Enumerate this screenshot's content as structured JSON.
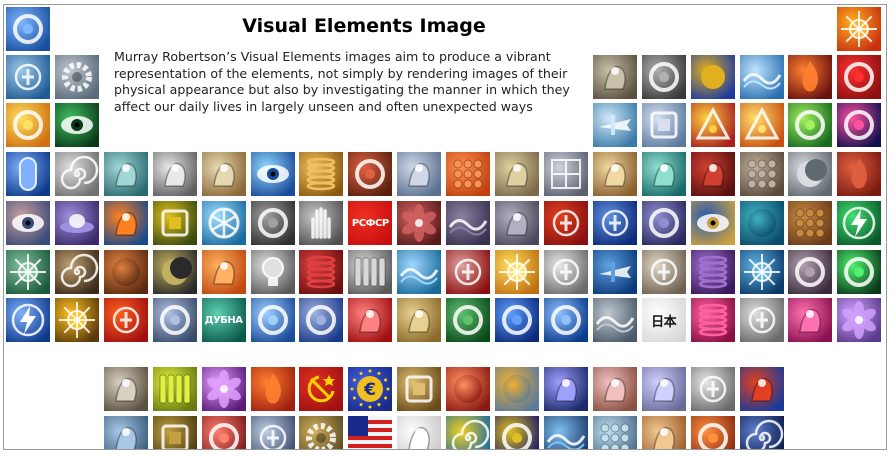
{
  "slide": {
    "title": "Visual Elements Image",
    "description": "Murray Robertson’s Visual Elements images aim to produce a vibrant representation of the elements, not simply by rendering images of their physical appearance but also by investigating the manner in which they affect our daily lives in largely unseen and often unexpected ways"
  },
  "tile_text": {
    "rsfsr": "РСФСР",
    "dubna": "ДУБНА",
    "nihon": "日本"
  },
  "palette": {
    "blue": "#1f4fa8",
    "darkblue": "#0e2a66",
    "red": "#c8281e",
    "orange": "#e8781e",
    "gold": "#c9a23a",
    "green": "#2e8a3a",
    "purple": "#6a3ca0",
    "grey": "#8a8f96",
    "teal": "#1f8f8f",
    "brown": "#7a5230"
  },
  "rows": [
    {
      "id": "r1",
      "tiles": [
        {
          "c1": "#1a4fa0",
          "c2": "#7fb6ff",
          "icon": "ring"
        },
        {
          "c1": "#c83010",
          "c2": "#ffb020",
          "icon": "sun"
        }
      ]
    },
    {
      "id": "r2",
      "tiles": [
        {
          "c1": "#1e5a96",
          "c2": "#9fc8e8",
          "icon": "symbol"
        },
        {
          "c1": "#5a6a7a",
          "c2": "#c0c8d0",
          "icon": "gear"
        },
        {
          "c1": "#5a5040",
          "c2": "#c8c0a8",
          "icon": "figure"
        },
        {
          "c1": "#3a3a3a",
          "c2": "#b0b0b0",
          "icon": "ring"
        },
        {
          "c1": "#1e3aa0",
          "c2": "#e0b020",
          "icon": "wheat"
        },
        {
          "c1": "#2a6fb0",
          "c2": "#c0e4ff",
          "icon": "wave"
        },
        {
          "c1": "#6a1010",
          "c2": "#ff8030",
          "icon": "flame"
        },
        {
          "c1": "#8a1010",
          "c2": "#ff3030",
          "icon": "ring"
        }
      ]
    },
    {
      "id": "r3",
      "tiles": [
        {
          "c1": "#d07010",
          "c2": "#ffe060",
          "icon": "ring"
        },
        {
          "c1": "#0a3a1a",
          "c2": "#40c060",
          "icon": "eye"
        },
        {
          "c1": "#3a7aa8",
          "c2": "#d0e8f8",
          "icon": "plane"
        },
        {
          "c1": "#5a7aa0",
          "c2": "#d8e0f0",
          "icon": "box"
        },
        {
          "c1": "#a82020",
          "c2": "#ffd040",
          "icon": "triangle"
        },
        {
          "c1": "#c85010",
          "c2": "#ffe070",
          "icon": "triangle"
        },
        {
          "c1": "#186a20",
          "c2": "#a0f060",
          "icon": "ring"
        },
        {
          "c1": "#101050",
          "c2": "#ff50a0",
          "icon": "ring"
        }
      ]
    },
    {
      "id": "r4",
      "tiles": [
        {
          "c1": "#0e3a8a",
          "c2": "#80b0ff",
          "icon": "capsule"
        },
        {
          "c1": "#707070",
          "c2": "#e0e0e0",
          "icon": "spiral"
        },
        {
          "c1": "#2a6a70",
          "c2": "#a0d8d8",
          "icon": "figure"
        },
        {
          "c1": "#606060",
          "c2": "#e8e8e8",
          "icon": "figure"
        },
        {
          "c1": "#8a6a3a",
          "c2": "#e8d8b0",
          "icon": "figure"
        },
        {
          "c1": "#1a4a9a",
          "c2": "#90d8ff",
          "icon": "eye"
        },
        {
          "c1": "#8a5a10",
          "c2": "#f0c060",
          "icon": "coil"
        },
        {
          "c1": "#5a2010",
          "c2": "#e06040",
          "icon": "ring"
        },
        {
          "c1": "#5a7090",
          "c2": "#d0d8e8",
          "icon": "figure"
        },
        {
          "c1": "#c04010",
          "c2": "#ff9050",
          "icon": "dots"
        },
        {
          "c1": "#7a6a4a",
          "c2": "#e0d0a0",
          "icon": "figure"
        },
        {
          "c1": "#5a6070",
          "c2": "#d0d4dc",
          "icon": "grid"
        },
        {
          "c1": "#8a6030",
          "c2": "#f0d8a0",
          "icon": "figure"
        },
        {
          "c1": "#1a6a6a",
          "c2": "#90e0d0",
          "icon": "figure"
        },
        {
          "c1": "#5a1010",
          "c2": "#d04030",
          "icon": "figure"
        },
        {
          "c1": "#5a4a3a",
          "c2": "#c0b0a0",
          "icon": "dots"
        },
        {
          "c1": "#606870",
          "c2": "#d8dce0",
          "icon": "moon"
        },
        {
          "c1": "#7a1a10",
          "c2": "#e06040",
          "icon": "flame"
        },
        {
          "c1": "#3a1020",
          "c2": "#c03050",
          "icon": "capsule"
        }
      ]
    },
    {
      "id": "r5",
      "tiles": [
        {
          "c1": "#3a4a7a",
          "c2": "#c8a0a0",
          "icon": "eye"
        },
        {
          "c1": "#3a2a6a",
          "c2": "#a090e0",
          "icon": "ufo"
        },
        {
          "c1": "#1a4a8a",
          "c2": "#ff8020",
          "icon": "figure"
        },
        {
          "c1": "#3a4a10",
          "c2": "#e0c020",
          "icon": "box"
        },
        {
          "c1": "#1a6aa0",
          "c2": "#a0e0ff",
          "icon": "wheel"
        },
        {
          "c1": "#303030",
          "c2": "#a0a0a0",
          "icon": "ring"
        },
        {
          "c1": "#505050",
          "c2": "#c8c8c8",
          "icon": "hand"
        },
        {
          "c1": "#c81010",
          "c2": "#f03020",
          "icon": "rsfsr"
        },
        {
          "c1": "#5a1a1a",
          "c2": "#d06060",
          "icon": "flower"
        },
        {
          "c1": "#3a3050",
          "c2": "#8a80a0",
          "icon": "wave"
        },
        {
          "c1": "#4a4a5a",
          "c2": "#b0b0c0",
          "icon": "figure"
        },
        {
          "c1": "#8a1010",
          "c2": "#e04020",
          "icon": "symbol"
        },
        {
          "c1": "#0e2a7a",
          "c2": "#6090e0",
          "icon": "symbol"
        },
        {
          "c1": "#2a2a60",
          "c2": "#9090d0",
          "icon": "ring"
        },
        {
          "c1": "#c8a040",
          "c2": "#2a5ab0",
          "icon": "eye"
        },
        {
          "c1": "#0a4a6a",
          "c2": "#40b0c0",
          "icon": "sphere"
        },
        {
          "c1": "#6a3a1a",
          "c2": "#c88a40",
          "icon": "dots"
        },
        {
          "c1": "#0a5a2a",
          "c2": "#40e070",
          "icon": "bolt"
        }
      ]
    },
    {
      "id": "r6",
      "tiles": [
        {
          "c1": "#1a5a3a",
          "c2": "#80c0a0",
          "icon": "sun"
        },
        {
          "c1": "#3a2a1a",
          "c2": "#c0a070",
          "icon": "spiral"
        },
        {
          "c1": "#5a2a10",
          "c2": "#e08040",
          "icon": "sphere"
        },
        {
          "c1": "#2a2a2a",
          "c2": "#c0b060",
          "icon": "moon"
        },
        {
          "c1": "#c04a10",
          "c2": "#ffb060",
          "icon": "figure"
        },
        {
          "c1": "#5a5a5a",
          "c2": "#e0e0e0",
          "icon": "bulb"
        },
        {
          "c1": "#6a1010",
          "c2": "#e04040",
          "icon": "coil"
        },
        {
          "c1": "#5a5a5a",
          "c2": "#d8d8d8",
          "icon": "bars"
        },
        {
          "c1": "#1a6a9a",
          "c2": "#a0d8ff",
          "icon": "wave"
        },
        {
          "c1": "#8a1010",
          "c2": "#e0a0a0",
          "icon": "symbol"
        },
        {
          "c1": "#c07010",
          "c2": "#ffe060",
          "icon": "sun"
        },
        {
          "c1": "#6a6a6a",
          "c2": "#e8e8e8",
          "icon": "symbol"
        },
        {
          "c1": "#0a3a7a",
          "c2": "#60a0e0",
          "icon": "plane"
        },
        {
          "c1": "#706050",
          "c2": "#e0d8c8",
          "icon": "symbol"
        },
        {
          "c1": "#3a1a5a",
          "c2": "#a070d0",
          "icon": "coil"
        },
        {
          "c1": "#0a3a6a",
          "c2": "#60b0e0",
          "icon": "sun"
        },
        {
          "c1": "#3a2a3a",
          "c2": "#b0a0b0",
          "icon": "ring"
        },
        {
          "c1": "#0a3a1a",
          "c2": "#50f070",
          "icon": "ring"
        }
      ]
    },
    {
      "id": "r7",
      "tiles": [
        {
          "c1": "#0e3a8a",
          "c2": "#80b0ff",
          "icon": "bolt"
        },
        {
          "c1": "#5a3a0a",
          "c2": "#ffc020",
          "icon": "sun"
        },
        {
          "c1": "#a01010",
          "c2": "#ff6020",
          "icon": "symbol"
        },
        {
          "c1": "#3a4a6a",
          "c2": "#b0c0e0",
          "icon": "ring"
        },
        {
          "c1": "#0a5a4a",
          "c2": "#60d0b0",
          "icon": "dubna"
        },
        {
          "c1": "#1a4a9a",
          "c2": "#a0d0ff",
          "icon": "ring"
        },
        {
          "c1": "#1a3a8a",
          "c2": "#a0b0e0",
          "icon": "ring"
        },
        {
          "c1": "#a01010",
          "c2": "#ff8080",
          "icon": "figure"
        },
        {
          "c1": "#8a6a2a",
          "c2": "#e8d090",
          "icon": "figure"
        },
        {
          "c1": "#0a4a1a",
          "c2": "#60c070",
          "icon": "ring"
        },
        {
          "c1": "#0a2a7a",
          "c2": "#60a0ff",
          "icon": "ring"
        },
        {
          "c1": "#0a3a8a",
          "c2": "#90c0ff",
          "icon": "ring"
        },
        {
          "c1": "#4a5a6a",
          "c2": "#c0c8d0",
          "icon": "wave"
        },
        {
          "c1": "#d8d8d8",
          "c2": "#ffffff",
          "icon": "nihon"
        },
        {
          "c1": "#8a1040",
          "c2": "#ff60a0",
          "icon": "coil"
        },
        {
          "c1": "#6a6a6a",
          "c2": "#e0e0e0",
          "icon": "symbol"
        },
        {
          "c1": "#8a1050",
          "c2": "#ff70b0",
          "icon": "figure"
        },
        {
          "c1": "#5a3a8a",
          "c2": "#d0a0ff",
          "icon": "flower"
        },
        {
          "c1": "#2a6a2a",
          "c2": "#e0c040",
          "icon": "bars"
        }
      ]
    },
    {
      "id": "r8",
      "tiles": [
        {
          "c1": "#5a5040",
          "c2": "#d8d0c0",
          "icon": "figure"
        },
        {
          "c1": "#6a7a10",
          "c2": "#e0f040",
          "icon": "bars"
        },
        {
          "c1": "#5a1a7a",
          "c2": "#e0a0ff",
          "icon": "flower"
        },
        {
          "c1": "#a02010",
          "c2": "#ff8030",
          "icon": "flame"
        },
        {
          "c1": "#a01010",
          "c2": "#e03020",
          "icon": "hammer"
        },
        {
          "c1": "#1a2a8a",
          "c2": "#4060e0",
          "icon": "euro"
        },
        {
          "c1": "#6a4a1a",
          "c2": "#e0c070",
          "icon": "box"
        },
        {
          "c1": "#8a1a10",
          "c2": "#ff9060",
          "icon": "sphere"
        },
        {
          "c1": "#5a7a9a",
          "c2": "#f0b030",
          "icon": "sphere"
        },
        {
          "c1": "#1a2a6a",
          "c2": "#a0a0ff",
          "icon": "figure"
        },
        {
          "c1": "#8a5040",
          "c2": "#f0c0c0",
          "icon": "figure"
        },
        {
          "c1": "#6a6a9a",
          "c2": "#d0d0ff",
          "icon": "figure"
        },
        {
          "c1": "#6a6a6a",
          "c2": "#e8e8e8",
          "icon": "symbol"
        },
        {
          "c1": "#1a3a9a",
          "c2": "#e04020",
          "icon": "figure"
        }
      ]
    },
    {
      "id": "r9",
      "tiles": [
        {
          "c1": "#3a5a7a",
          "c2": "#a8c8e8",
          "icon": "figure"
        },
        {
          "c1": "#4a3a10",
          "c2": "#c0a040",
          "icon": "box"
        },
        {
          "c1": "#7a1a1a",
          "c2": "#ff8070",
          "icon": "ring"
        },
        {
          "c1": "#3a4a6a",
          "c2": "#c0d0e8",
          "icon": "symbol"
        },
        {
          "c1": "#5a4a20",
          "c2": "#d0b060",
          "icon": "gear"
        },
        {
          "c1": "#1a2a8a",
          "c2": "#e02020",
          "icon": "flag"
        },
        {
          "c1": "#c8c8c8",
          "c2": "#ffffff",
          "icon": "figure"
        },
        {
          "c1": "#1a6aa0",
          "c2": "#f0d020",
          "icon": "spiral"
        },
        {
          "c1": "#1a1a6a",
          "c2": "#e0c020",
          "icon": "ring"
        },
        {
          "c1": "#1a3a6a",
          "c2": "#80c0f0",
          "icon": "wave"
        },
        {
          "c1": "#4a6a8a",
          "c2": "#c0e0f0",
          "icon": "dots"
        },
        {
          "c1": "#9a5a2a",
          "c2": "#f0c890",
          "icon": "figure"
        },
        {
          "c1": "#8a2a10",
          "c2": "#ff9040",
          "icon": "ring"
        },
        {
          "c1": "#0a1a4a",
          "c2": "#6080d0",
          "icon": "spiral"
        }
      ]
    }
  ]
}
